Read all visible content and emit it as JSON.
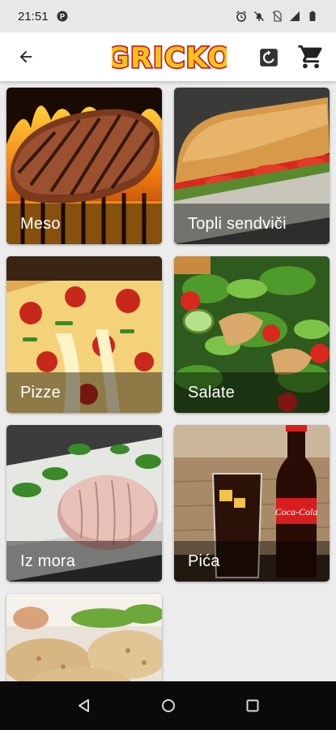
{
  "status_bar": {
    "time": "21:51",
    "icons": [
      "app-notification-icon",
      "alarm-icon",
      "mute-icon",
      "no-sim-icon",
      "signal-icon",
      "battery-icon"
    ]
  },
  "app_bar": {
    "logo_text": "GRICKO",
    "icons": [
      "back-arrow-icon",
      "refresh-icon",
      "shopping-cart-icon"
    ],
    "colors": {
      "logo_fill": "#f7c21b",
      "logo_outline": "#c8161e"
    }
  },
  "categories": [
    {
      "label": "Meso",
      "image": "grilled-steak"
    },
    {
      "label": "Topli sendviči",
      "image": "sandwich"
    },
    {
      "label": "Pizze",
      "image": "pizza"
    },
    {
      "label": "Salate",
      "image": "salad"
    },
    {
      "label": "Iz mora",
      "image": "tuna"
    },
    {
      "label": "Pića",
      "image": "cola-drinks"
    },
    {
      "label": "",
      "image": "flatbread"
    }
  ],
  "nav_bar": {
    "icons": [
      "nav-back-icon",
      "nav-home-icon",
      "nav-recents-icon"
    ]
  }
}
